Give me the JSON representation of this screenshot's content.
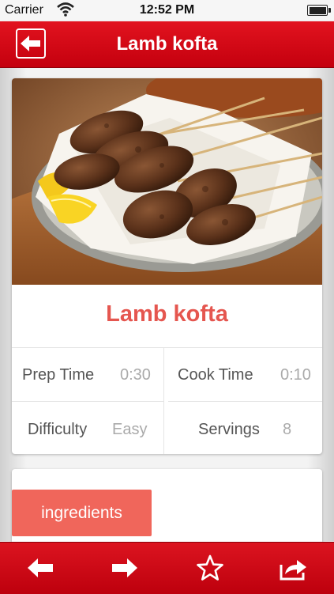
{
  "status_bar": {
    "carrier": "Carrier",
    "time": "12:52 PM",
    "icons": [
      "wifi-icon",
      "battery-icon"
    ]
  },
  "nav": {
    "title": "Lamb kofta",
    "back_icon": "back-arrow-icon"
  },
  "recipe": {
    "title": "Lamb kofta",
    "photo_icon": "food-photo",
    "stats": [
      {
        "label": "Prep Time",
        "value": "0:30"
      },
      {
        "label": "Cook Time",
        "value": "0:10"
      },
      {
        "label": "Difficulty",
        "value": "Easy"
      },
      {
        "label": "Servings",
        "value": "8"
      }
    ]
  },
  "section": {
    "tab_label": "ingredients"
  },
  "toolbar": {
    "items": [
      "previous-arrow-icon",
      "next-arrow-icon",
      "star-icon",
      "share-icon"
    ]
  },
  "colors": {
    "brand_red": "#d50a16",
    "title_red": "#e5564f",
    "tab_salmon": "#f0665b"
  }
}
